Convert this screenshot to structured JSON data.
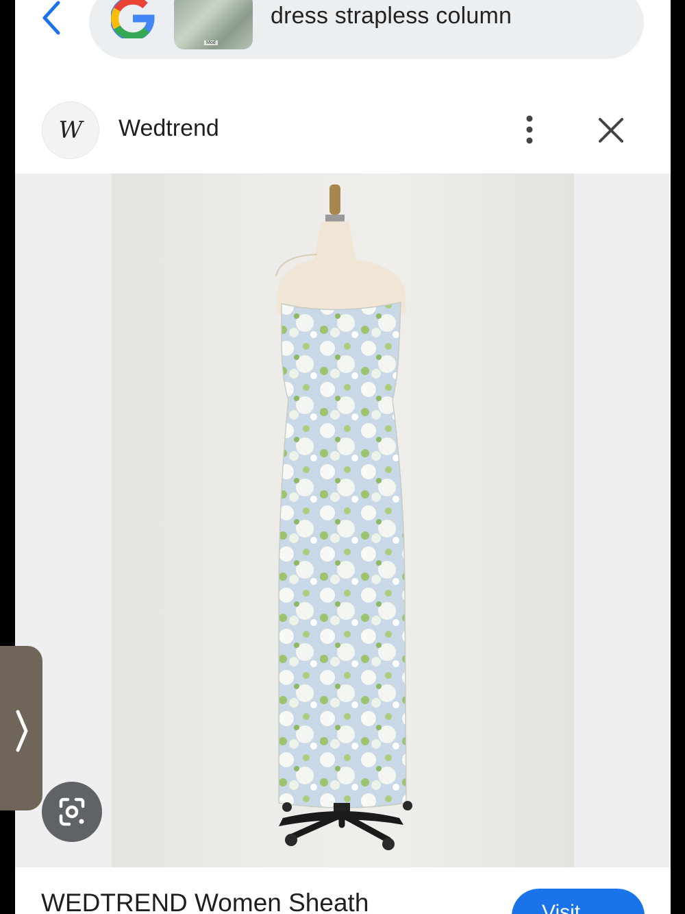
{
  "search": {
    "query": "dress strapless column",
    "thumbnail_tag": "Mod"
  },
  "site": {
    "logo_text": "W",
    "name": "Wedtrend"
  },
  "product": {
    "title": "WEDTREND Women Sheath",
    "visit_label": "Visit"
  },
  "icons": {
    "back": "chevron-left-icon",
    "google": "google-g-logo",
    "more": "vertical-dots-icon",
    "close": "close-icon",
    "handle": "chevron-right-icon",
    "lens": "google-lens-icon"
  },
  "colors": {
    "accent": "#1a73e8",
    "search_bg": "#eceff1",
    "dress_blue": "#c9d8e6",
    "dress_green": "#9cc36e"
  }
}
